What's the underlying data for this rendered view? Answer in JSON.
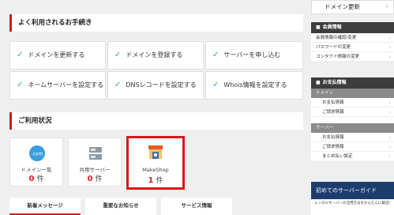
{
  "frequent": {
    "title": "よく利用されるお手続き",
    "items": [
      {
        "label": "ドメインを更新する"
      },
      {
        "label": "ドメインを登録する"
      },
      {
        "label": "サーバーを申し込む"
      },
      {
        "label": "ネームサーバーを設定する"
      },
      {
        "label": "DNSレコードを設定する"
      },
      {
        "label": "Whois情報を設定する"
      }
    ]
  },
  "usage": {
    "title": "ご利用状況",
    "tiles": [
      {
        "label": "ドメイン一覧",
        "count": "0",
        "unit": "件",
        "icon": "dotcom-icon"
      },
      {
        "label": "共用サーバー",
        "count": "0",
        "unit": "件",
        "icon": "server-icon"
      },
      {
        "label": "MakeShop",
        "count": "1",
        "unit": "件",
        "icon": "shop-icon"
      }
    ]
  },
  "tabs": [
    {
      "label": "新着メッセージ"
    },
    {
      "label": "重要なお知らせ"
    },
    {
      "label": "サービス情報"
    }
  ],
  "sidebar": {
    "renew_button": "ドメイン更新",
    "member": {
      "title": "会員情報",
      "links": [
        "会員情報の確認/変更",
        "パスワードの変更",
        "コンタクト情報の変更"
      ]
    },
    "payment": {
      "title": "お支払情報",
      "domain_cat": "ドメイン",
      "domain_links": [
        "お支払情報",
        "ご請求情報"
      ],
      "server_cat": "サーバー",
      "server_links": [
        "お支払情報",
        "ご請求情報",
        "まとめ払い設定"
      ]
    },
    "banner": {
      "title": "初めてのサーバーガイド",
      "text": "レンタルサーバーの活用方法をかんたんに解説!"
    }
  },
  "colors": {
    "accent": "#c81e1e",
    "check": "#2aa0de",
    "count": "#d4261f"
  }
}
